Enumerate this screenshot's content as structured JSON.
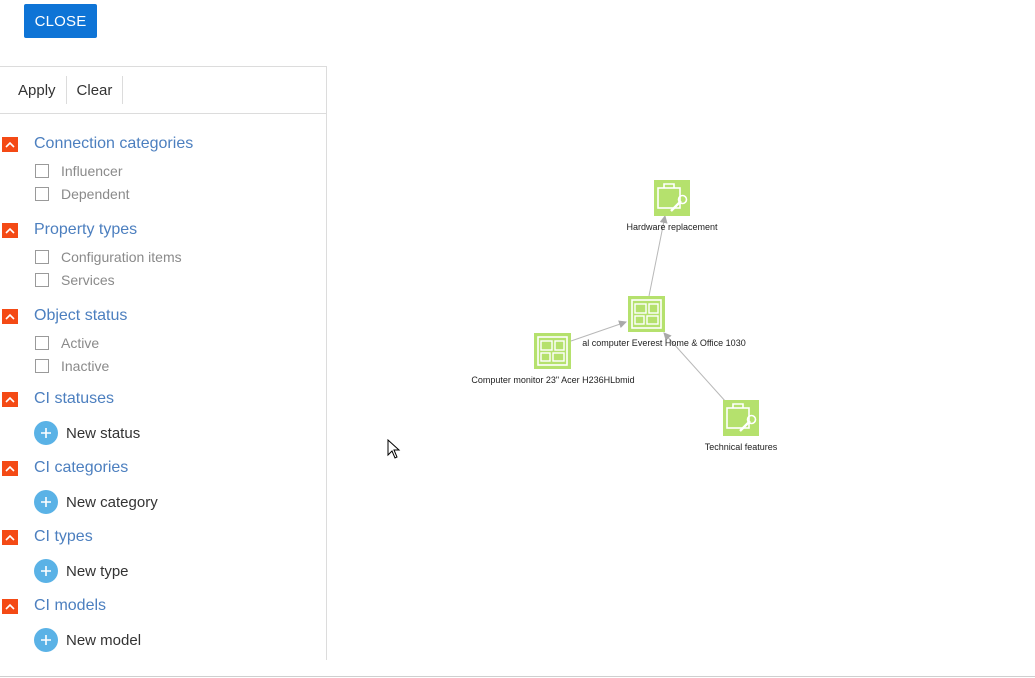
{
  "close_label": "CLOSE",
  "toolbar": {
    "apply_label": "Apply",
    "clear_label": "Clear"
  },
  "sections": [
    {
      "title": "Connection categories",
      "checkboxes": [
        "Influencer",
        "Dependent"
      ]
    },
    {
      "title": "Property types",
      "checkboxes": [
        "Configuration items",
        "Services"
      ]
    },
    {
      "title": "Object status",
      "checkboxes": [
        "Active",
        "Inactive"
      ]
    },
    {
      "title": "CI statuses",
      "add_label": "New status"
    },
    {
      "title": "CI categories",
      "add_label": "New category"
    },
    {
      "title": "CI types",
      "add_label": "New type"
    },
    {
      "title": "CI models",
      "add_label": "New model"
    }
  ],
  "graph": {
    "nodes": [
      {
        "label": "Hardware replacement",
        "icon": "briefcase-wrench-icon"
      },
      {
        "label": "al computer Everest Home & Office 1030",
        "icon": "computer-system-icon"
      },
      {
        "label": "Computer monitor 23\" Acer H236HLbmid",
        "icon": "computer-system-icon"
      },
      {
        "label": "Technical features",
        "icon": "briefcase-wrench-icon"
      }
    ],
    "node_color": "#b5e16d",
    "edge_color": "#b0b0b0"
  },
  "colors": {
    "accent": "#0e74d6",
    "toggle": "#f44a15",
    "section_title": "#4c7fbf",
    "add_button": "#5ab2e6"
  }
}
